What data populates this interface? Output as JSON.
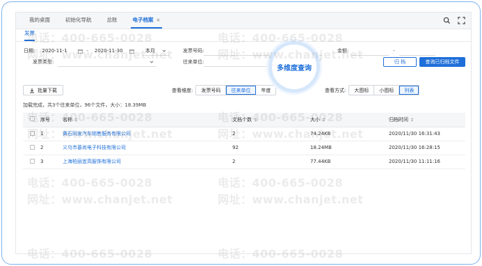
{
  "tabs": [
    {
      "label": "我的桌面",
      "active": false
    },
    {
      "label": "初始化导航",
      "active": false
    },
    {
      "label": "总账",
      "active": false
    },
    {
      "label": "电子档案",
      "active": true,
      "close": "×"
    }
  ],
  "subtab": "发票",
  "filters": {
    "date_label": "日期:",
    "date_from": "2020-11-1",
    "date_sep": "-",
    "date_to": "2020-11-30",
    "period": "本月",
    "invoice_no_label": "发票号码:",
    "amount_label": "金额:",
    "amount_sep": "-",
    "invoice_type_label": "发票类型:",
    "partner_label": "往来单位:",
    "archive_button": "归 档",
    "query_button": "查询已归档文件"
  },
  "toolbar": {
    "download_label": "批量下载",
    "dimension_label": "查看维度:",
    "dimension_options": [
      "发票号码",
      "往来单位",
      "年度"
    ],
    "dimension_selected": "往来单位",
    "view_label": "查看方式:",
    "view_options": [
      "大图标",
      "小图标",
      "列表"
    ],
    "view_selected": "列表"
  },
  "summary": "加载完成，共3个往来单位，96个文件，大小：18.39MB",
  "table": {
    "headers": [
      "序号",
      "名称",
      "文档个数",
      "大小",
      "归档时间"
    ],
    "rows": [
      {
        "index": "1",
        "name": "黄石同发汽车销售服务有限公司",
        "count": "2",
        "size": "74.24KB",
        "time": "2020/11/30 16:31:43"
      },
      {
        "index": "2",
        "name": "义乌市碁尚电子科技有限公司",
        "count": "92",
        "size": "18.24MB",
        "time": "2020/11/30 16:28:15"
      },
      {
        "index": "3",
        "name": "上海柏丽宜高服饰有限公司",
        "count": "2",
        "size": "77.44KB",
        "time": "2020/11/30 11:11:16"
      }
    ]
  },
  "callout": "多维度查询",
  "watermark": {
    "phone": "电话：400-665-0028",
    "site": "网址：www.chanjet.net"
  },
  "colors": {
    "accent": "#1e6fd9",
    "frame": "#7fb0ea"
  }
}
